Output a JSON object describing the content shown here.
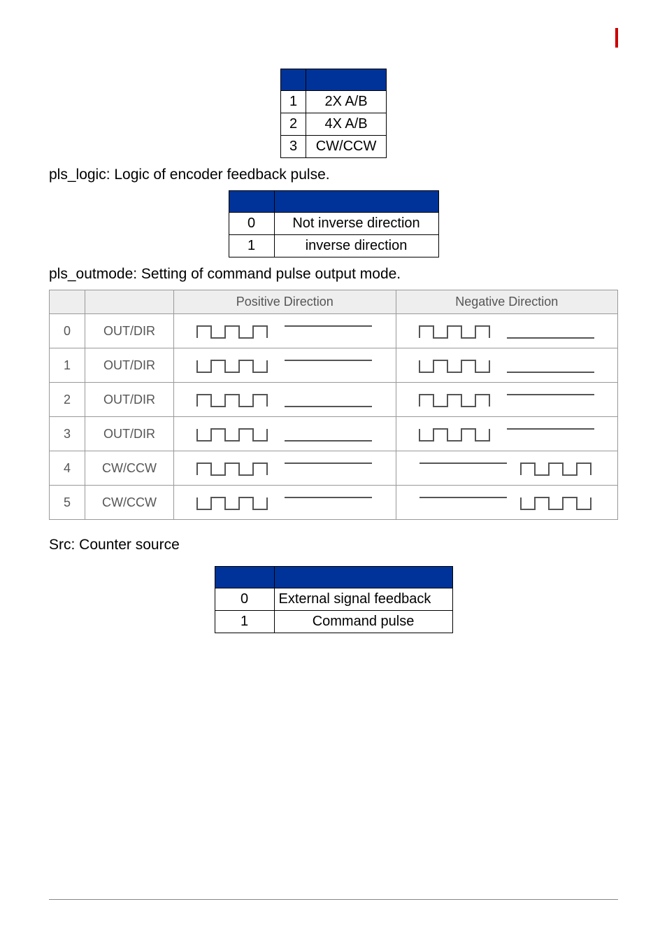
{
  "table1": {
    "header": [
      "",
      ""
    ],
    "rows": [
      {
        "val": "1",
        "desc": "2X A/B"
      },
      {
        "val": "2",
        "desc": "4X A/B"
      },
      {
        "val": "3",
        "desc": "CW/CCW"
      }
    ]
  },
  "caption_logic": "pls_logic: Logic of encoder feedback pulse.",
  "table2": {
    "header": [
      "",
      ""
    ],
    "rows": [
      {
        "val": "0",
        "desc": "Not inverse direction"
      },
      {
        "val": "1",
        "desc": "inverse direction"
      }
    ]
  },
  "caption_outmode": "pls_outmode: Setting of command pulse output mode.",
  "outmode": {
    "headers": [
      "",
      "",
      "Positive Direction",
      "Negative Direction"
    ],
    "rows": [
      {
        "idx": "0",
        "mode": "OUT/DIR"
      },
      {
        "idx": "1",
        "mode": "OUT/DIR"
      },
      {
        "idx": "2",
        "mode": "OUT/DIR"
      },
      {
        "idx": "3",
        "mode": "OUT/DIR"
      },
      {
        "idx": "4",
        "mode": "CW/CCW"
      },
      {
        "idx": "5",
        "mode": "CW/CCW"
      }
    ]
  },
  "caption_src": "Src: Counter source",
  "table3": {
    "header": [
      "",
      ""
    ],
    "rows": [
      {
        "val": "0",
        "desc": "External signal feedback"
      },
      {
        "val": "1",
        "desc": "Command pulse"
      }
    ]
  }
}
